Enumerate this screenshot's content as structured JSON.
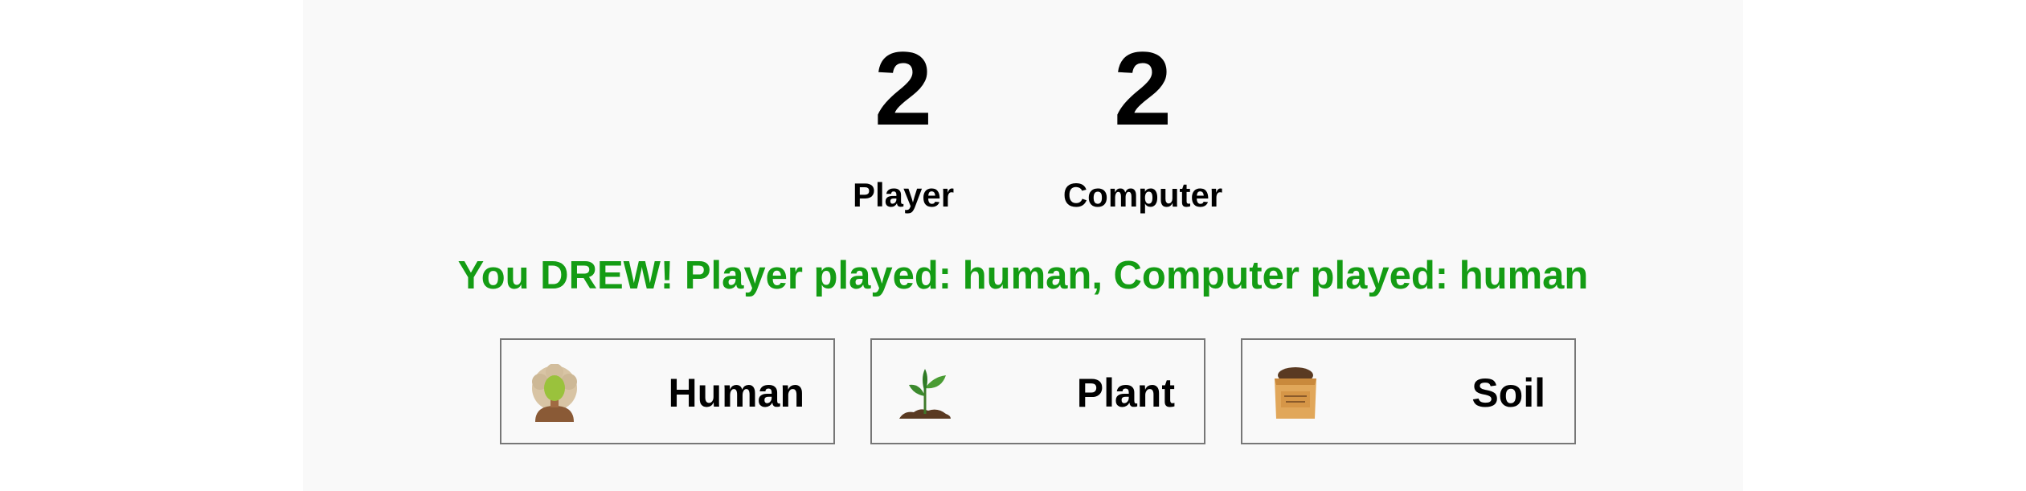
{
  "scoreboard": {
    "player_score": "2",
    "computer_score": "2",
    "player_label": "Player",
    "computer_label": "Computer"
  },
  "result": {
    "message": "You DREW! Player played: human, Computer played: human",
    "color": "#149c14"
  },
  "choices": [
    {
      "label": "Human",
      "icon": "human-icon"
    },
    {
      "label": "Plant",
      "icon": "sprout-icon"
    },
    {
      "label": "Soil",
      "icon": "soil-bag-icon"
    }
  ]
}
